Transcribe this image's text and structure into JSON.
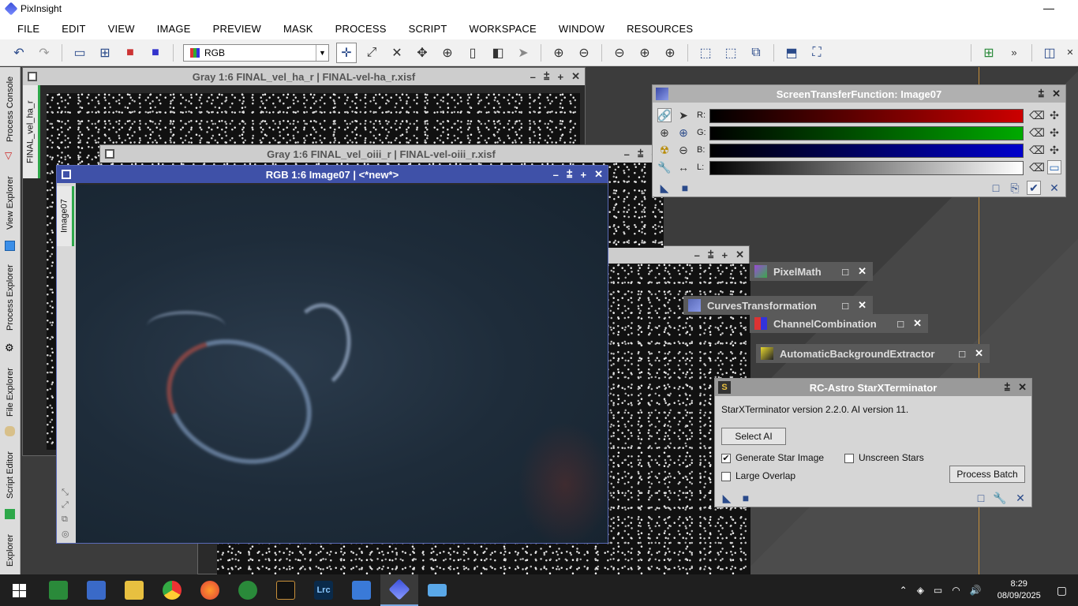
{
  "app": {
    "title": "PixInsight",
    "minimize": "—"
  },
  "menu": [
    "FILE",
    "EDIT",
    "VIEW",
    "IMAGE",
    "PREVIEW",
    "MASK",
    "PROCESS",
    "SCRIPT",
    "WORKSPACE",
    "WINDOW",
    "RESOURCES"
  ],
  "toolbar": {
    "color_mode": "RGB",
    "overflow": "»"
  },
  "left_tabs": [
    "Process Console",
    "View Explorer",
    "Process Explorer",
    "File Explorer",
    "Script Editor",
    "Explorer"
  ],
  "windows": {
    "ha": {
      "title": "Gray 1:6 FINAL_vel_ha_r | FINAL-vel-ha_r.xisf",
      "side_tab": "FINAL_vel_ha_r"
    },
    "oiii": {
      "title": "Gray 1:6 FINAL_vel_oiii_r | FINAL-vel-oiii_r.xisf"
    },
    "rgb": {
      "title": "RGB 1:6 Image07 | <*new*>",
      "side_tab": "Image07"
    },
    "controls": {
      "min": "–",
      "shade": "⩲",
      "max": "+",
      "close": "✕"
    }
  },
  "stf": {
    "title": "ScreenTransferFunction: Image07",
    "labels": {
      "r": "R:",
      "g": "G:",
      "b": "B:",
      "l": "L:"
    },
    "colors": {
      "r": "#cc0000",
      "g": "#00aa00",
      "b": "#0000cc"
    }
  },
  "process_icons": [
    {
      "label": "PixelMath"
    },
    {
      "label": "CurvesTransformation"
    },
    {
      "label": "ChannelCombination"
    },
    {
      "label": "AutomaticBackgroundExtractor"
    }
  ],
  "sxt": {
    "title": "RC-Astro StarXTerminator",
    "version": "StarXTerminator version 2.2.0. AI version 11.",
    "select_ai": "Select AI",
    "generate_star_image": "Generate Star Image",
    "unscreen_stars": "Unscreen Stars",
    "large_overlap": "Large Overlap",
    "process_batch": "Process Batch",
    "generate_checked": true,
    "unscreen_checked": false,
    "large_overlap_checked": false
  },
  "taskbar": {
    "time": "8:29",
    "date": "08/09/2025"
  }
}
